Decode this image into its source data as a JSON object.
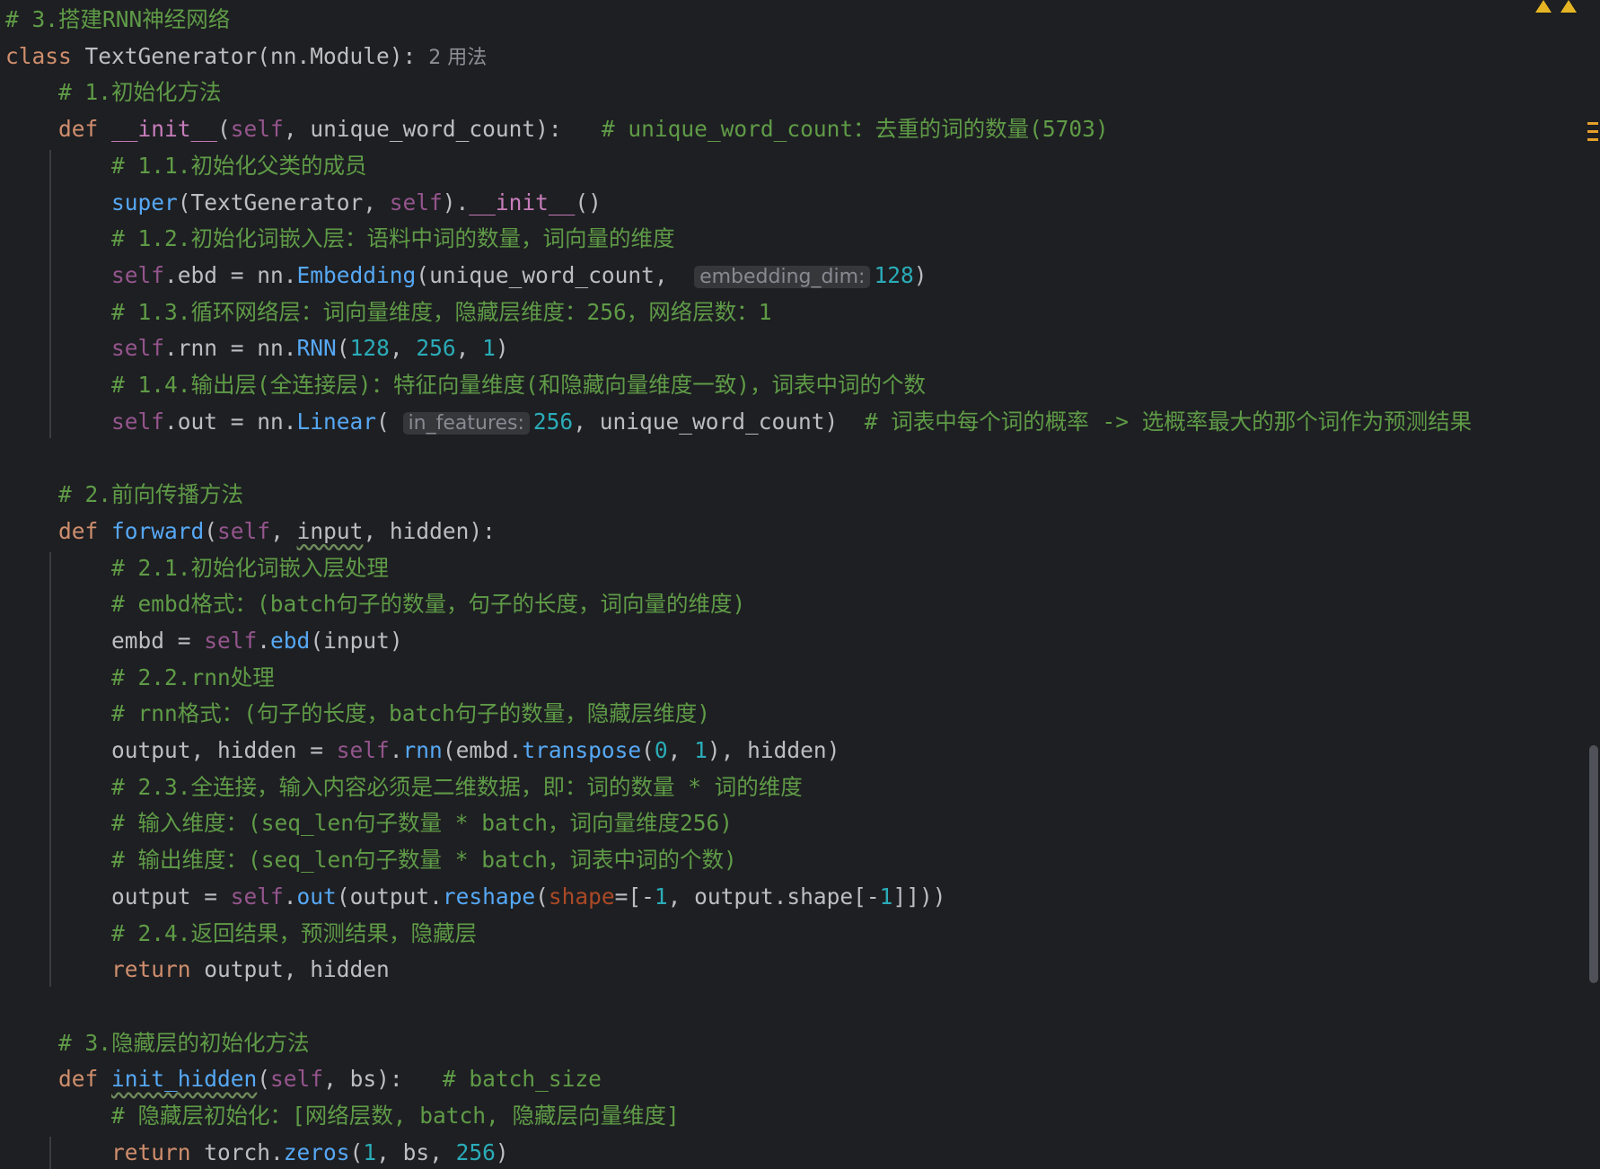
{
  "editor": {
    "language": "python",
    "lines": [
      {
        "indent": 0,
        "tokens": [
          {
            "c": "cmt",
            "t": "# 3.搭建RNN神经网络"
          }
        ]
      },
      {
        "indent": 0,
        "tokens": [
          {
            "c": "kw",
            "t": "class "
          },
          {
            "c": "cls",
            "t": "TextGenerator"
          },
          {
            "c": "txt",
            "t": "(nn.Module):"
          },
          {
            "c": "hint",
            "t": "  2 用法"
          }
        ]
      },
      {
        "indent": 1,
        "tokens": [
          {
            "c": "cmt",
            "t": "# 1.初始化方法"
          }
        ]
      },
      {
        "indent": 1,
        "tokens": [
          {
            "c": "kw",
            "t": "def "
          },
          {
            "c": "dunder",
            "t": "__init__"
          },
          {
            "c": "txt",
            "t": "("
          },
          {
            "c": "self",
            "t": "self"
          },
          {
            "c": "txt",
            "t": ", "
          },
          {
            "c": "param",
            "t": "unique_word_count"
          },
          {
            "c": "txt",
            "t": "):   "
          },
          {
            "c": "cmt",
            "t": "# unique_word_count：去重的词的数量(5703)"
          }
        ]
      },
      {
        "indent": 2,
        "tokens": [
          {
            "c": "cmt",
            "t": "# 1.1.初始化父类的成员"
          }
        ]
      },
      {
        "indent": 2,
        "tokens": [
          {
            "c": "fcall",
            "t": "super"
          },
          {
            "c": "txt",
            "t": "(TextGenerator, "
          },
          {
            "c": "self",
            "t": "self"
          },
          {
            "c": "txt",
            "t": ")."
          },
          {
            "c": "dunder",
            "t": "__init__"
          },
          {
            "c": "txt",
            "t": "()"
          }
        ]
      },
      {
        "indent": 2,
        "tokens": [
          {
            "c": "cmt",
            "t": "# 1.2.初始化词嵌入层：语料中词的数量，词向量的维度"
          }
        ]
      },
      {
        "indent": 2,
        "tokens": [
          {
            "c": "self",
            "t": "self"
          },
          {
            "c": "txt",
            "t": ".ebd = nn."
          },
          {
            "c": "fcall",
            "t": "Embedding"
          },
          {
            "c": "txt",
            "t": "("
          },
          {
            "c": "param",
            "t": "unique_word_count"
          },
          {
            "c": "txt",
            "t": ",  "
          },
          {
            "c": "inlay",
            "t": "embedding_dim:"
          },
          {
            "c": "num",
            "t": "128"
          },
          {
            "c": "txt",
            "t": ")"
          }
        ]
      },
      {
        "indent": 2,
        "tokens": [
          {
            "c": "cmt",
            "t": "# 1.3.循环网络层：词向量维度，隐藏层维度：256，网络层数：1"
          }
        ]
      },
      {
        "indent": 2,
        "tokens": [
          {
            "c": "self",
            "t": "self"
          },
          {
            "c": "txt",
            "t": ".rnn = nn."
          },
          {
            "c": "fcall",
            "t": "RNN"
          },
          {
            "c": "txt",
            "t": "("
          },
          {
            "c": "num",
            "t": "128"
          },
          {
            "c": "txt",
            "t": ", "
          },
          {
            "c": "num",
            "t": "256"
          },
          {
            "c": "txt",
            "t": ", "
          },
          {
            "c": "num",
            "t": "1"
          },
          {
            "c": "txt",
            "t": ")"
          }
        ]
      },
      {
        "indent": 2,
        "tokens": [
          {
            "c": "cmt",
            "t": "# 1.4.输出层(全连接层)：特征向量维度(和隐藏向量维度一致)，词表中词的个数"
          }
        ]
      },
      {
        "indent": 2,
        "tokens": [
          {
            "c": "self",
            "t": "self"
          },
          {
            "c": "txt",
            "t": ".out = nn."
          },
          {
            "c": "fcall",
            "t": "Linear"
          },
          {
            "c": "txt",
            "t": "( "
          },
          {
            "c": "inlay",
            "t": "in_features:"
          },
          {
            "c": "num",
            "t": "256"
          },
          {
            "c": "txt",
            "t": ", "
          },
          {
            "c": "param",
            "t": "unique_word_count"
          },
          {
            "c": "txt",
            "t": ")  "
          },
          {
            "c": "cmt",
            "t": "# 词表中每个词的概率 -> 选概率最大的那个词作为预测结果"
          }
        ]
      },
      {
        "indent": 0,
        "tokens": []
      },
      {
        "indent": 1,
        "tokens": [
          {
            "c": "cmt",
            "t": "# 2.前向传播方法"
          }
        ]
      },
      {
        "indent": 1,
        "tokens": [
          {
            "c": "kw",
            "t": "def "
          },
          {
            "c": "fn",
            "t": "forward"
          },
          {
            "c": "txt",
            "t": "("
          },
          {
            "c": "self",
            "t": "self"
          },
          {
            "c": "txt",
            "t": ", "
          },
          {
            "c": "squig",
            "t": "input"
          },
          {
            "c": "txt",
            "t": ", "
          },
          {
            "c": "param",
            "t": "hidden"
          },
          {
            "c": "txt",
            "t": "):"
          }
        ]
      },
      {
        "indent": 2,
        "tokens": [
          {
            "c": "cmt",
            "t": "# 2.1.初始化词嵌入层处理"
          }
        ]
      },
      {
        "indent": 2,
        "tokens": [
          {
            "c": "cmt",
            "t": "# embd格式：(batch句子的数量，句子的长度，词向量的维度)"
          }
        ]
      },
      {
        "indent": 2,
        "tokens": [
          {
            "c": "txt",
            "t": "embd = "
          },
          {
            "c": "self",
            "t": "self"
          },
          {
            "c": "txt",
            "t": "."
          },
          {
            "c": "fcall",
            "t": "ebd"
          },
          {
            "c": "txt",
            "t": "("
          },
          {
            "c": "param",
            "t": "input"
          },
          {
            "c": "txt",
            "t": ")"
          }
        ]
      },
      {
        "indent": 2,
        "tokens": [
          {
            "c": "cmt",
            "t": "# 2.2.rnn处理"
          }
        ]
      },
      {
        "indent": 2,
        "tokens": [
          {
            "c": "cmt",
            "t": "# rnn格式：(句子的长度，batch句子的数量，隐藏层维度)"
          }
        ]
      },
      {
        "indent": 2,
        "tokens": [
          {
            "c": "txt",
            "t": "output, hidden = "
          },
          {
            "c": "self",
            "t": "self"
          },
          {
            "c": "txt",
            "t": "."
          },
          {
            "c": "fcall",
            "t": "rnn"
          },
          {
            "c": "txt",
            "t": "(embd."
          },
          {
            "c": "fcall",
            "t": "transpose"
          },
          {
            "c": "txt",
            "t": "("
          },
          {
            "c": "num",
            "t": "0"
          },
          {
            "c": "txt",
            "t": ", "
          },
          {
            "c": "num",
            "t": "1"
          },
          {
            "c": "txt",
            "t": "), "
          },
          {
            "c": "param",
            "t": "hidden"
          },
          {
            "c": "txt",
            "t": ")"
          }
        ]
      },
      {
        "indent": 2,
        "tokens": [
          {
            "c": "cmt",
            "t": "# 2.3.全连接，输入内容必须是二维数据，即：词的数量 * 词的维度"
          }
        ]
      },
      {
        "indent": 2,
        "tokens": [
          {
            "c": "cmt",
            "t": "# 输入维度：(seq_len句子数量 * batch，词向量维度256)"
          }
        ]
      },
      {
        "indent": 2,
        "tokens": [
          {
            "c": "cmt",
            "t": "# 输出维度：(seq_len句子数量 * batch，词表中词的个数)"
          }
        ]
      },
      {
        "indent": 2,
        "tokens": [
          {
            "c": "txt",
            "t": "output = "
          },
          {
            "c": "self",
            "t": "self"
          },
          {
            "c": "txt",
            "t": "."
          },
          {
            "c": "fcall",
            "t": "out"
          },
          {
            "c": "txt",
            "t": "(output."
          },
          {
            "c": "fcall",
            "t": "reshape"
          },
          {
            "c": "txt",
            "t": "("
          },
          {
            "c": "named",
            "t": "shape"
          },
          {
            "c": "txt",
            "t": "=[-"
          },
          {
            "c": "num",
            "t": "1"
          },
          {
            "c": "txt",
            "t": ", output.shape[-"
          },
          {
            "c": "num",
            "t": "1"
          },
          {
            "c": "txt",
            "t": "]]))"
          }
        ]
      },
      {
        "indent": 2,
        "tokens": [
          {
            "c": "cmt",
            "t": "# 2.4.返回结果，预测结果，隐藏层"
          }
        ]
      },
      {
        "indent": 2,
        "tokens": [
          {
            "c": "kw",
            "t": "return "
          },
          {
            "c": "txt",
            "t": "output, "
          },
          {
            "c": "param",
            "t": "hidden"
          }
        ]
      },
      {
        "indent": 0,
        "tokens": []
      },
      {
        "indent": 1,
        "tokens": [
          {
            "c": "cmt",
            "t": "# 3.隐藏层的初始化方法"
          }
        ]
      },
      {
        "indent": 1,
        "tokens": [
          {
            "c": "kw",
            "t": "def "
          },
          {
            "c": "squigfn",
            "t": "init_hidden"
          },
          {
            "c": "txt",
            "t": "("
          },
          {
            "c": "self",
            "t": "self"
          },
          {
            "c": "txt",
            "t": ", "
          },
          {
            "c": "param",
            "t": "bs"
          },
          {
            "c": "txt",
            "t": "):   "
          },
          {
            "c": "cmt",
            "t": "# batch_size"
          }
        ]
      },
      {
        "indent": 2,
        "tokens": [
          {
            "c": "cmt",
            "t": "# 隐藏层初始化：[网络层数, batch, 隐藏层向量维度]"
          }
        ]
      },
      {
        "indent": 2,
        "tokens": [
          {
            "c": "kw",
            "t": "return "
          },
          {
            "c": "txt",
            "t": "torch."
          },
          {
            "c": "fcall",
            "t": "zeros"
          },
          {
            "c": "txt",
            "t": "("
          },
          {
            "c": "num",
            "t": "1"
          },
          {
            "c": "txt",
            "t": ", "
          },
          {
            "c": "param",
            "t": "bs"
          },
          {
            "c": "txt",
            "t": ", "
          },
          {
            "c": "num",
            "t": "256"
          },
          {
            "c": "txt",
            "t": ")"
          }
        ]
      }
    ]
  },
  "colors": {
    "background": "#1e1f22",
    "comment": "#5f9b47",
    "keyword": "#cf8e6d",
    "function": "#56a8f5",
    "number": "#2aacb8",
    "self": "#94558d",
    "warning": "#e5b523"
  }
}
